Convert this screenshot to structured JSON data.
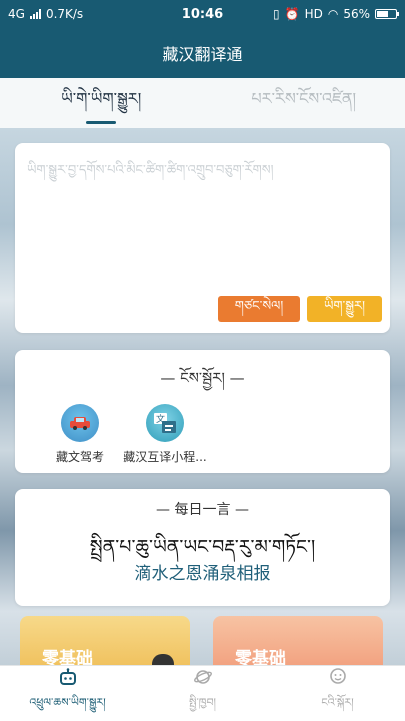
{
  "status": {
    "network": "4G",
    "speed": "0.7K/s",
    "time": "10:46",
    "hd": "HD",
    "battery": "56%"
  },
  "title": "藏汉翻译通",
  "tabs": [
    {
      "label": "ཡི་གེ་ཡིག་སྒྱུར།",
      "active": true
    },
    {
      "label": "པར་རིས་ངོས་འཛིན།",
      "active": false
    }
  ],
  "input": {
    "placeholder": "ཡིག་སྒྱུར་བྱ་དགོས་པའི་མིང་ཚིག་ཚིག་འགྲུབ་བཅུག་རོགས།",
    "clear_label": "གཙང་སེལ།",
    "translate_label": "ཡིག་སྒྱུར།"
  },
  "more": {
    "title": "— ངོས་སྦྱོར། —",
    "apps": [
      {
        "name": "藏文驾考",
        "icon": "car-exam-icon"
      },
      {
        "name": "藏汉互译小程...",
        "icon": "translate-mini-icon"
      }
    ]
  },
  "quote": {
    "title": "— 每日一言 —",
    "tibetan": "སྤྲིན་པ་ཆུ་ཡིན་ཡང་བརྡ་རུ་མ་གཏོང་།",
    "chinese": "滴水之恩涌泉相报"
  },
  "promos": [
    {
      "label": "零基础"
    },
    {
      "label": "零基础"
    }
  ],
  "nav": [
    {
      "label": "འཕྲུལ་ཆས་ཡིག་སྒྱུར།",
      "icon": "robot-icon",
      "active": true
    },
    {
      "label": "སྤྱི་ཁྱབ།",
      "icon": "planet-icon",
      "active": false
    },
    {
      "label": "ངའི་སྐོར།",
      "icon": "user-icon",
      "active": false
    }
  ],
  "colors": {
    "primary": "#185a72",
    "clear_button": "#ea7b30",
    "translate_button": "#f2b227"
  }
}
